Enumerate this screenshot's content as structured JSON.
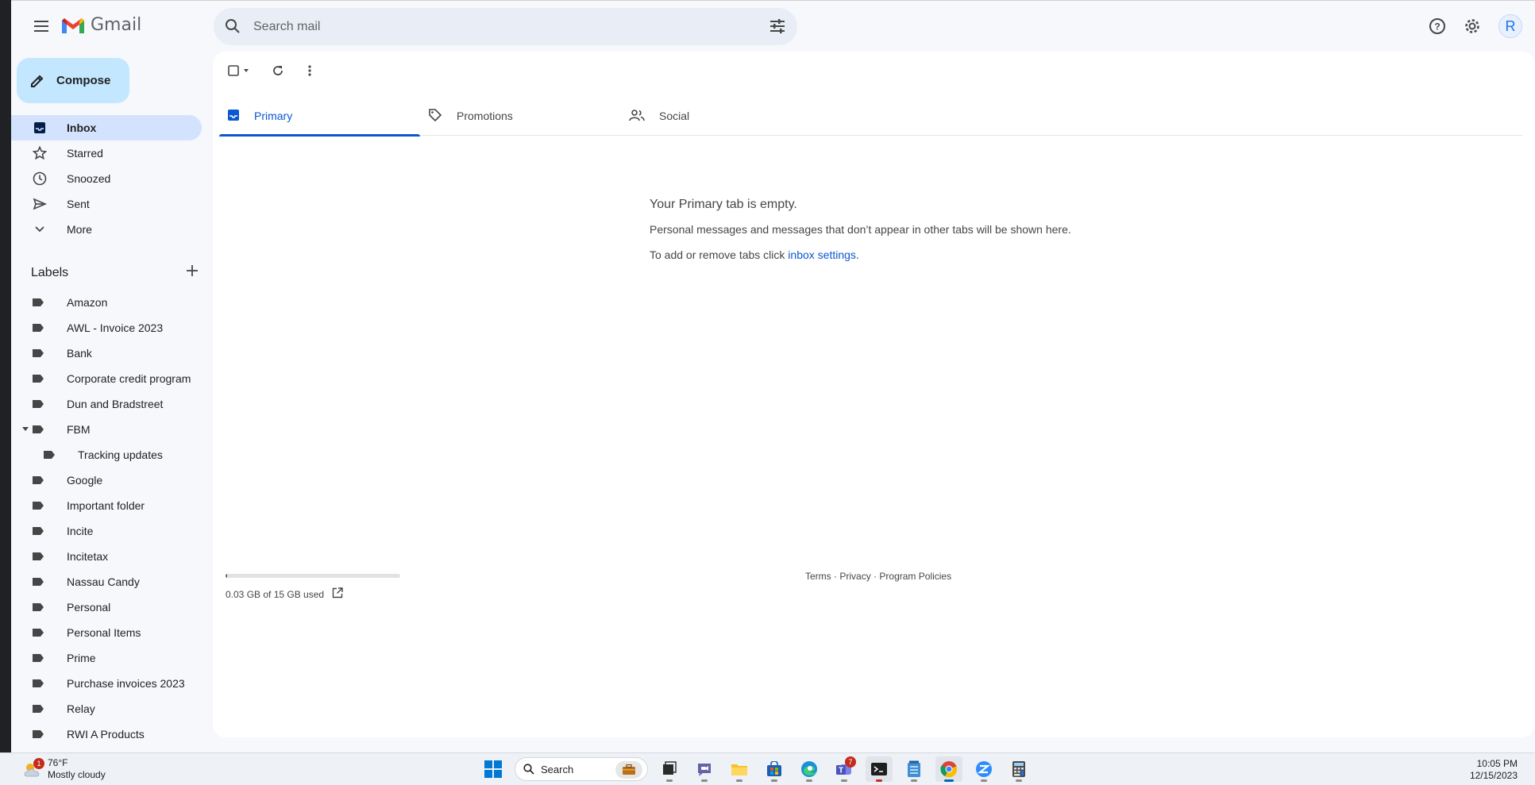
{
  "header": {
    "app_name": "Gmail",
    "search_placeholder": "Search mail",
    "avatar_letter": "R"
  },
  "sidebar": {
    "compose_label": "Compose",
    "nav": [
      {
        "label": "Inbox",
        "icon": "inbox-icon",
        "active": true
      },
      {
        "label": "Starred",
        "icon": "star-icon"
      },
      {
        "label": "Snoozed",
        "icon": "clock-icon"
      },
      {
        "label": "Sent",
        "icon": "send-icon"
      },
      {
        "label": "More",
        "icon": "chevron-down-icon"
      }
    ],
    "labels_heading": "Labels",
    "labels": [
      "Amazon",
      "AWL - Invoice 2023",
      "Bank",
      "Corporate credit program",
      "Dun and Bradstreet",
      "FBM",
      "Tracking updates",
      "Google",
      "Important folder",
      "Incite",
      "Incitetax",
      "Nassau Candy",
      "Personal",
      "Personal Items",
      "Prime",
      "Purchase invoices 2023",
      "Relay",
      "RWI A Products"
    ]
  },
  "tabs": [
    {
      "label": "Primary",
      "icon": "inbox-icon",
      "active": true
    },
    {
      "label": "Promotions",
      "icon": "tag-icon"
    },
    {
      "label": "Social",
      "icon": "people-icon"
    }
  ],
  "empty_state": {
    "title": "Your Primary tab is empty.",
    "line1": "Personal messages and messages that don’t appear in other tabs will be shown here.",
    "line2_prefix": "To add or remove tabs click ",
    "line2_link": "inbox settings",
    "line2_suffix": "."
  },
  "storage": {
    "text": "0.03 GB of 15 GB used",
    "used_fraction": 0.002
  },
  "footer": {
    "terms": "Terms",
    "sep": "·",
    "privacy": "Privacy",
    "policies": "Program Policies"
  },
  "taskbar": {
    "weather_temp": "76°F",
    "weather_desc": "Mostly cloudy",
    "weather_badge": "1",
    "search_label": "Search",
    "teams_badge": "7",
    "time": "10:05 PM",
    "date": "12/15/2023"
  },
  "colors": {
    "accent": "#0b57d0",
    "compose_bg": "#c2e7ff",
    "active_nav_bg": "#d3e3fd"
  }
}
